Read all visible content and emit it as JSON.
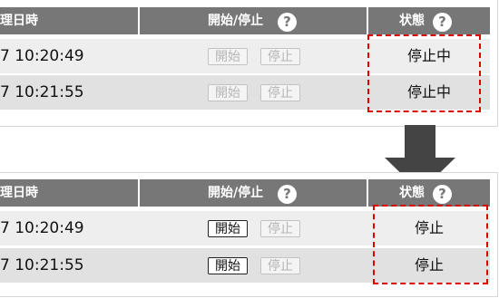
{
  "header": {
    "datetime_label": "理日時",
    "control_label": "開始/停止",
    "status_label": "状態",
    "help_glyph": "?"
  },
  "before": {
    "rows": [
      {
        "time": "7 10:20:49",
        "start_label": "開始",
        "stop_label": "停止",
        "status": "停止中"
      },
      {
        "time": "7 10:21:55",
        "start_label": "開始",
        "stop_label": "停止",
        "status": "停止中"
      }
    ]
  },
  "after": {
    "rows": [
      {
        "time": "7 10:20:49",
        "start_label": "開始",
        "stop_label": "停止",
        "status": "停止"
      },
      {
        "time": "7 10:21:55",
        "start_label": "開始",
        "stop_label": "停止",
        "status": "停止"
      }
    ]
  },
  "colors": {
    "header_bg": "#777777",
    "row_bg": "#eeeeee",
    "row_alt_bg": "#e1e1e1",
    "highlight_border": "#dd0000",
    "arrow": "#444444"
  },
  "icons": {
    "help": "question-circle-icon",
    "arrow": "arrow-down-icon"
  }
}
